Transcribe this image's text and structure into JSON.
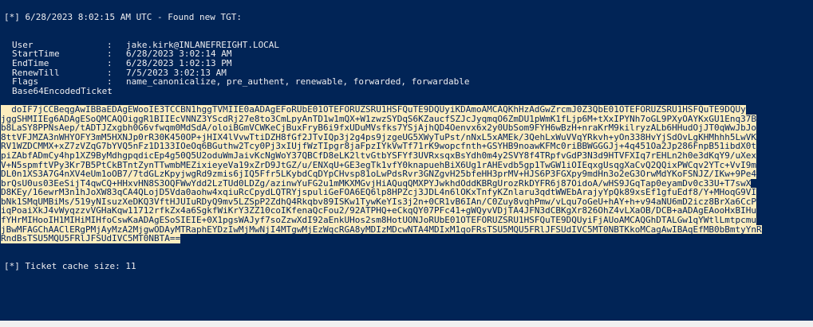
{
  "header": "[*] 6/28/2023 8:02:15 AM UTC - Found new TGT:",
  "fields": [
    {
      "key": "User",
      "value": "jake.kirk@INLANEFREIGHT.LOCAL"
    },
    {
      "key": "StartTime",
      "value": "6/28/2023 3:02:14 AM"
    },
    {
      "key": "EndTime",
      "value": "6/28/2023 1:02:13 PM"
    },
    {
      "key": "RenewTill",
      "value": "7/5/2023 3:02:13 AM"
    },
    {
      "key": "Flags",
      "value": "name_canonicalize, pre_authent, renewable, forwarded, forwardable"
    },
    {
      "key": "Base64EncodedTicket",
      "value": ""
    }
  ],
  "separator": ":",
  "ticket_lines": [
    "  doIF7jCCBeqgAwIBBaEDAgEWooIE3TCCBN1hggTVMIIE0aADAgEFoRUbE01OTEFORUZSRU1HSFQuTE9DQUyiKDAmoAMCAQKhHzAdGwZrcmJ0Z3QbE01OTEFORUZSRU1HSFQuTE9DQUy",
    "jggSHMIIEg6ADAgESoQMCAQOiggR1BIIEcVNNZ3YScdRj27e8to3CmLpyAnTD1w1mQX+W1zwzSYDqS6KZaucfSZJcJyqmqO6ZmDU1pWmK1fLjp6M+tXxIPYNh7oGL9PXyOAYKxGU1Enq37B",
    "b8LaSY8PPNsAep/tADTJZxgbh0G6vfwqm0MdSdA/oloiBGmVCWKeCjBuxFryB6i9fxUDuMVsfks7YSjAjhQD4Oenvx6x2y0UbSom9FYH6wBzH+nraKrM9kilryzALb6HHudOjJT0qWwJbJo",
    "8ttVFJMZA3nWHYOFY3mM5HXNJp0rR30K450OP+jHIX4lVvwTtiDZH8fGf2JTvIQp3j2g4ps9jzgeUG5XWyTuPst/nNxL5xAMEk/3QehLxWuVVqYRkvh+yOn338HvYjSdOvLgKHMhhh5LwVK",
    "RV1WZDCMMX+xZ7zVZqG7bYVQ5nFz1D133IOeOq6BGuthw2Tcy0Pj3xIUjfWzTIpgr8jaFpzIYkVwTf71rK9wopcfnth+GSYHB9noawKFMc0riBBWGGGJj+4q451Oa2Jp286FnpB51ibdX0t",
    "piZAbfADmCy4hp1XZ9ByMdhgpqdicEp4g50Q5U2oduWmJaivKcNgWoY37QBCfD8eLK2ltvGtbYSFYf3UVRxsqxBsYdh0m4y2SVY8f4TRpfvGdP3N3d9HTVFXIq7rEHLn2h0e3dKqY9/uXex",
    "V+N5spmftVPy3Kr7B5PtCkBTntZynTTwmbMEZixieyeVa19xZrD9JtGZ/u/ENXqU+GE3egTk1vfY0knapuehBiX6Ug1rAHEvdb5gp1TwGW1iOIEqxgUsqgXaCvQ2QQixPWCqv2YTc+VvI9m",
    "DL0n1XS3A7G4nXV4eUm1oOB7/7tdGLzKpyjwgRd9zmis6jIQ5Ffr5LKybdCqDYpCHvsp81oLwPdsRvr3GNZgvH25bfeHH3prMV+HJS6P3FGXpy9mdHn3o2eG3OrwMdYKoFSNJZ/IKw+9Pe4",
    "brQsU0us03EeSijT4qwCQ+HHxvHN8S3OQFWwYdd2LzTUd0LDZg/azinwYuFG2u1mMKXMGvjHiAQuqQMXPYJwkhdOddKBRgUrozRkDYFR6j87OidoA/wHS9JGqTap0eyamDv0c33U+T7swX",
    "D8KEy/16ewrM3n1hJoXW83qCA4QLojD5Vda0aohw4xqiuRcCpydLQTRYjspuliGeFOA6EQ6lp8HPZcj3JDL4n6lOKxTnfyKZnlaru3qdtWWEbArajyYpQk89xsEf1gfuEdf8/Y+MHoqG9VI",
    "bNk1SMqUMBiMs/519yNIsuzXeDKQ3VftHJUIuRDyQ9mv5LZSpP2ZdhQ4Rkqbv89ISKw1TywKeYIs3j2n+0CR1vB6IAn/C0Zuy8vqhPmw/vLqu7oGeU+hAY+h+v94aNU6mD2icz8BrXa6CcP",
    "iqPoaiXkJ4vWyqzzvVGHaKqw11712rfkZx4a6SgkfWiKrY3ZZ10coIKfenaQcFou2/92ATPHQ+eCkqQY07PFc41+gWQyvVDjTA4JFN3dCBKgXr826OhZ4vLXaOB/DCB+aADAgEAooHxBIHu",
    "fYHrMIHooIH1MIHiMIHfoCswKaADAgESoSIEIE+0X1pgsWAJyf7soZzwXdI92aEnkUHos2sm8HotUONJoRUbE01OTEFORUZSRU1HSFQuTE9DQUyiFjAUoAMCAQGhDTALGw1qYWtlLmtpcmu",
    "jBwMFAGChAAClERgPMjAyMzA2MjgwODAyMTRaphEYDzIwMjMwNjI4MTgwMjEzWqcRGA8yMDIzMDcwNTA4MDIxM1qoFRsTSU5MQU5FRlJFSUdIVC5MT0NBTKkoMCagAwIBAqEfMB0bBmtyYnR",
    "RndBsTSU5MQU5FRlJFSUdIVC5MT0NBTA=="
  ],
  "footer": "[*] Ticket cache size: 11"
}
